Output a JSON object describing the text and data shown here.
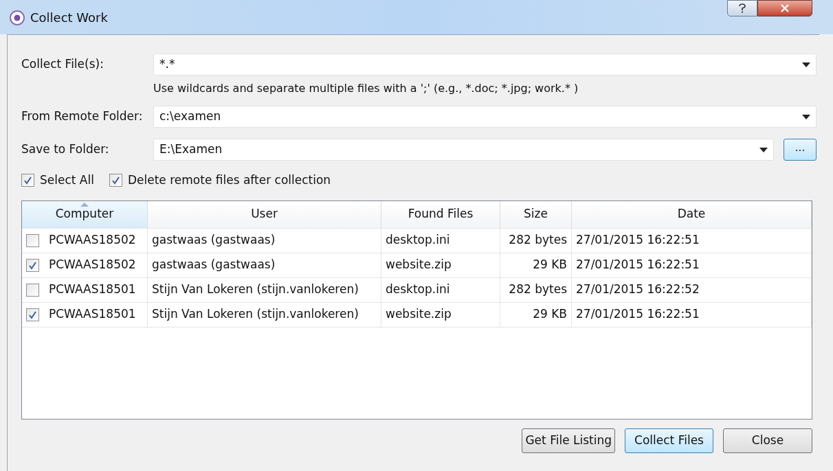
{
  "window": {
    "title": "Collect Work"
  },
  "fields": [
    {
      "label": "Collect File(s):",
      "value": "*.*",
      "hint": "Use wildcards and separate multiple files with a ';' (e.g., *.doc; *.jpg; work.* )"
    },
    {
      "label": "From Remote Folder:",
      "value": "c:\\examen"
    },
    {
      "label": "Save to Folder:",
      "value": "E:\\Examen",
      "browse": "..."
    }
  ],
  "options": [
    {
      "label": "Select All",
      "checked": true
    },
    {
      "label": "Delete remote files after collection",
      "checked": true
    }
  ],
  "table": {
    "columns": [
      {
        "label": "Computer",
        "sorted": true
      },
      {
        "label": "User",
        "sorted": false
      },
      {
        "label": "Found Files",
        "sorted": false
      },
      {
        "label": "Size",
        "sorted": false
      },
      {
        "label": "Date",
        "sorted": false
      }
    ],
    "rows": [
      {
        "checked": false,
        "cells": [
          "PCWAAS18502",
          "gastwaas (gastwaas)",
          "desktop.ini",
          "282 bytes",
          "27/01/2015 16:22:51"
        ]
      },
      {
        "checked": true,
        "cells": [
          "PCWAAS18502",
          "gastwaas (gastwaas)",
          "website.zip",
          "29 KB",
          "27/01/2015 16:22:51"
        ]
      },
      {
        "checked": false,
        "cells": [
          "PCWAAS18501",
          "Stijn Van Lokeren (stijn.vanlokeren)",
          "desktop.ini",
          "282 bytes",
          "27/01/2015 16:22:52"
        ]
      },
      {
        "checked": true,
        "cells": [
          "PCWAAS18501",
          "Stijn Van Lokeren (stijn.vanlokeren)",
          "website.zip",
          "29 KB",
          "27/01/2015 16:22:51"
        ]
      }
    ]
  },
  "buttons": [
    {
      "label": "Get File Listing",
      "selected": false
    },
    {
      "label": "Collect Files",
      "selected": true
    },
    {
      "label": "Close",
      "selected": false
    }
  ]
}
